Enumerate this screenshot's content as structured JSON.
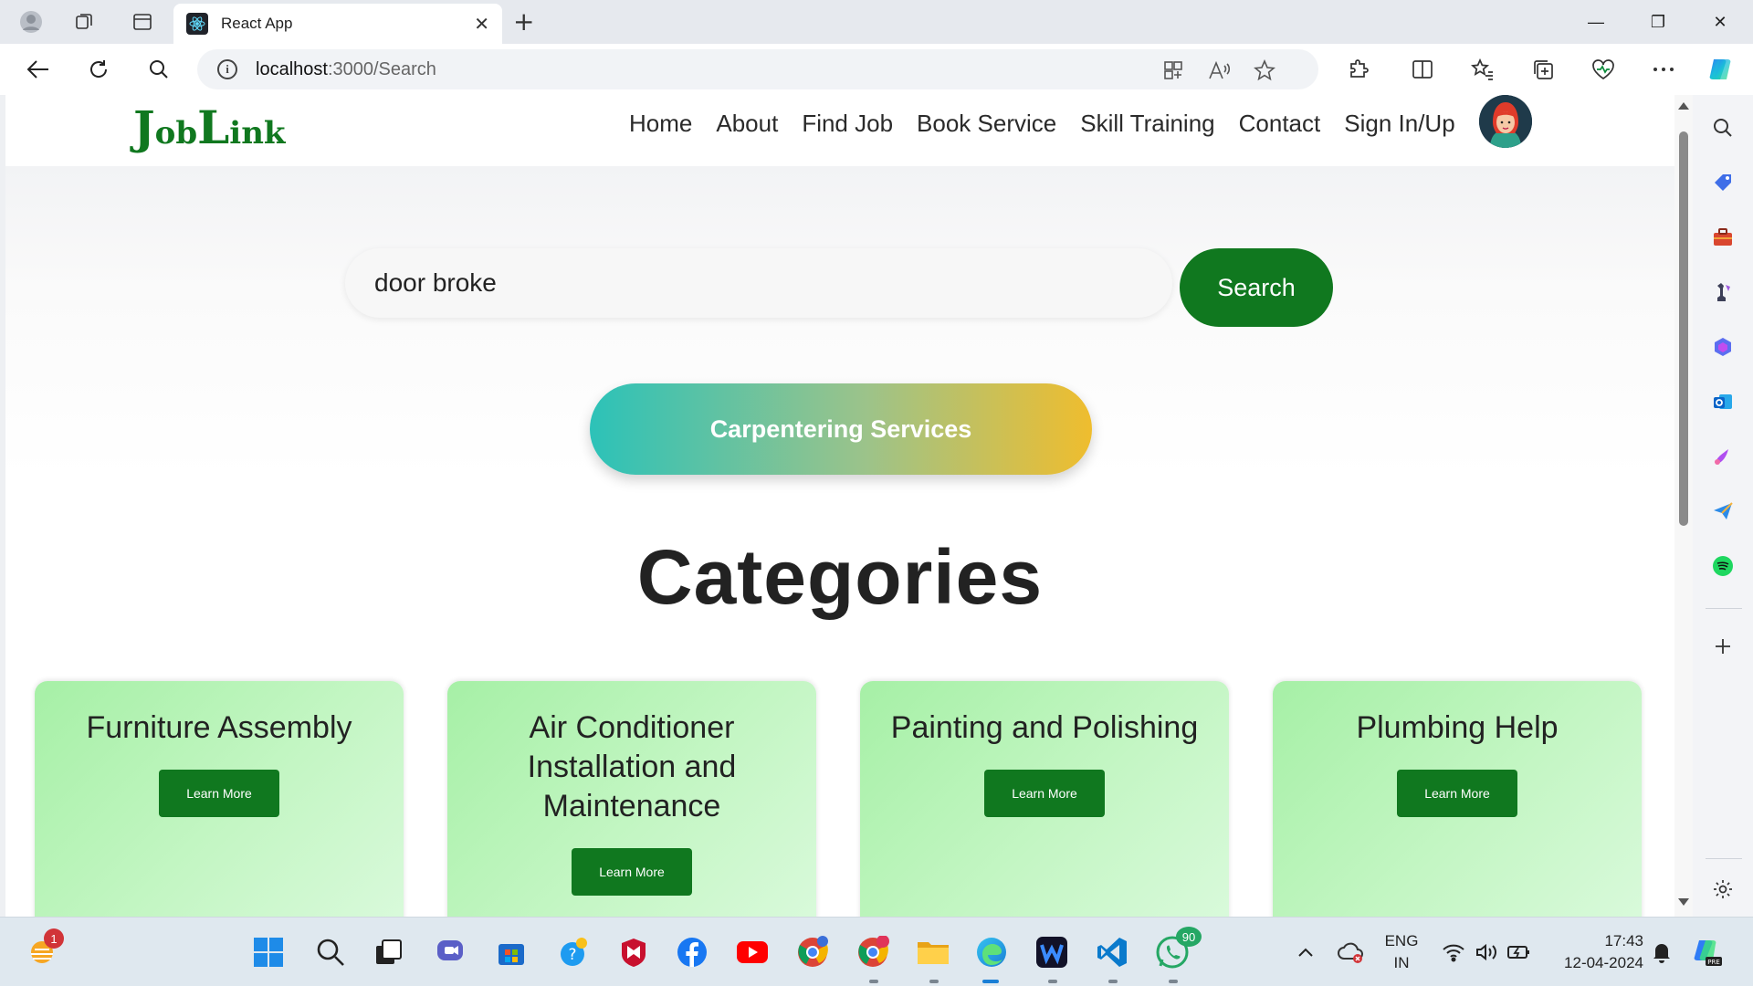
{
  "browser": {
    "tab_title": "React App",
    "tab_close": "✕",
    "new_tab": "+",
    "url_host": "localhost",
    "url_path": ":3000/Search",
    "window_controls": {
      "minimize": "—",
      "restore": "❐",
      "close": "✕"
    }
  },
  "site": {
    "logo_first_big": "J",
    "logo_first_rest": "ob",
    "logo_second_big": "L",
    "logo_second_rest": "ink",
    "nav": [
      "Home",
      "About",
      "Find Job",
      "Book Service",
      "Skill Training",
      "Contact",
      "Sign In/Up"
    ]
  },
  "search": {
    "value": "door broke",
    "button_label": "Search"
  },
  "result_service": "Carpentering Services",
  "categories": {
    "heading": "Categories",
    "cards": [
      {
        "title": "Furniture Assembly",
        "button": "Learn More"
      },
      {
        "title": "Air Conditioner Installation and Maintenance",
        "button": "Learn More"
      },
      {
        "title": "Painting and Polishing",
        "button": "Learn More"
      },
      {
        "title": "Plumbing Help",
        "button": "Learn More"
      }
    ]
  },
  "taskbar": {
    "notification_badge": "1",
    "whatsapp_badge": "90",
    "lang_top": "ENG",
    "lang_bottom": "IN",
    "time": "17:43",
    "date": "12-04-2024"
  },
  "colors": {
    "brand_green": "#10781f",
    "card_gradient_start": "#a6f0a6",
    "pill_gradient_start": "#2cc2b8",
    "pill_gradient_end": "#efbd2e"
  }
}
